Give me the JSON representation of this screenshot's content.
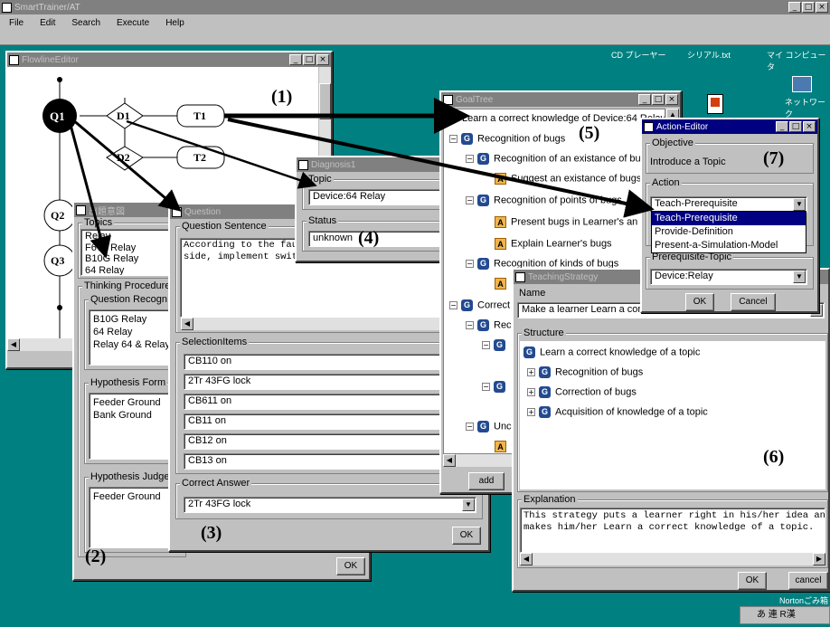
{
  "main_window": {
    "title": "SmartTrainer/AT",
    "menu": [
      "File",
      "Edit",
      "Search",
      "Execute",
      "Help"
    ]
  },
  "desktop": {
    "icon_labels": [
      "CD プレーヤー",
      "シリアル.txt",
      "マイ コンピュータ",
      "ネットワーク"
    ],
    "norton_label": "Nortonごみ箱",
    "taskbar_ime": "あ 連 R漢"
  },
  "annotations": [
    "(1)",
    "(2)",
    "(3)",
    "(4)",
    "(5)",
    "(6)",
    "(7)"
  ],
  "flowline_editor": {
    "title": "FlowlineEditor",
    "nodes": [
      "Q1",
      "D1",
      "T1",
      "D2",
      "T2",
      "Q2",
      "Q3"
    ]
  },
  "window2": {
    "title": "出題意図",
    "topics_label": "Topics",
    "topics": [
      "Relay",
      "F670 Relay",
      "B10G Relay",
      "64 Relay"
    ],
    "thinking_label": "Thinking Procedure",
    "question_recog_label": "Question Recogn",
    "question_recog_items": [
      "B10G Relay",
      "64 Relay",
      "Relay 64 & Relay"
    ],
    "hypothesis_form_label": "Hypothesis Form",
    "hypothesis_form_items": [
      "Feeder Ground",
      "Bank Ground"
    ],
    "hypothesis_judge_label": "Hypothesis Judge",
    "hypothesis_judge_items": [
      "Feeder Ground"
    ],
    "ok": "OK"
  },
  "question": {
    "title": "Question",
    "sentence_label": "Question Sentence",
    "sentence_lines": [
      "According to the fau",
      "side, implement swit"
    ],
    "selection_label": "SelectionItems",
    "selection_items": [
      "CB110 on",
      "2Tr 43FG lock",
      "CB611 on",
      "CB11 on",
      "CB12 on",
      "CB13 on"
    ],
    "correct_label": "Correct Answer",
    "correct_value": "2Tr 43FG lock",
    "ok": "OK"
  },
  "diagnosis": {
    "title": "Diagnosis1",
    "topic_label": "Topic",
    "topic_value": "Device:64 Relay",
    "status_label": "Status",
    "status_value": "unknown"
  },
  "goal_tree": {
    "title": "GoalTree",
    "items": [
      "Learn a correct knowledge of Device:64 Relay",
      "Recognition of bugs",
      "Recognition of an existance of bu",
      "Suggest an existance of bugs",
      "Recognition of points of bugs",
      "Present bugs in Learner's an",
      "Explain Learner's bugs",
      "Recognition of kinds of bugs",
      "Correct",
      "Rec",
      "Unc"
    ],
    "add": "add"
  },
  "teaching_strategy": {
    "title": "TeachingStrategy",
    "name_label": "Name",
    "name_value": "Make a learner Learn a cor",
    "structure_label": "Structure",
    "structure_items": [
      "Learn a correct knowledge of a topic",
      "Recognition of bugs",
      "Correction of bugs",
      "Acquisition of knowledge of a topic"
    ],
    "explanation_label": "Explanation",
    "explanation_lines": [
      "This strategy puts a learner right in his/her idea and",
      "makes him/her Learn a correct knowledge of a topic."
    ],
    "ok": "OK",
    "cancel": "cancel"
  },
  "action_editor": {
    "title": "Action-Editor",
    "objective_label": "Objective",
    "objective_value": "Introduce a Topic",
    "action_label": "Action",
    "action_value": "Teach-Prerequisite",
    "action_options": [
      "Teach-Prerequisite",
      "Provide-Definition",
      "Present-a-Simulation-Model"
    ],
    "prereq_label": "Prerequisite-Topic",
    "prereq_value": "Device:Relay",
    "ok": "OK",
    "cancel": "Cancel"
  }
}
